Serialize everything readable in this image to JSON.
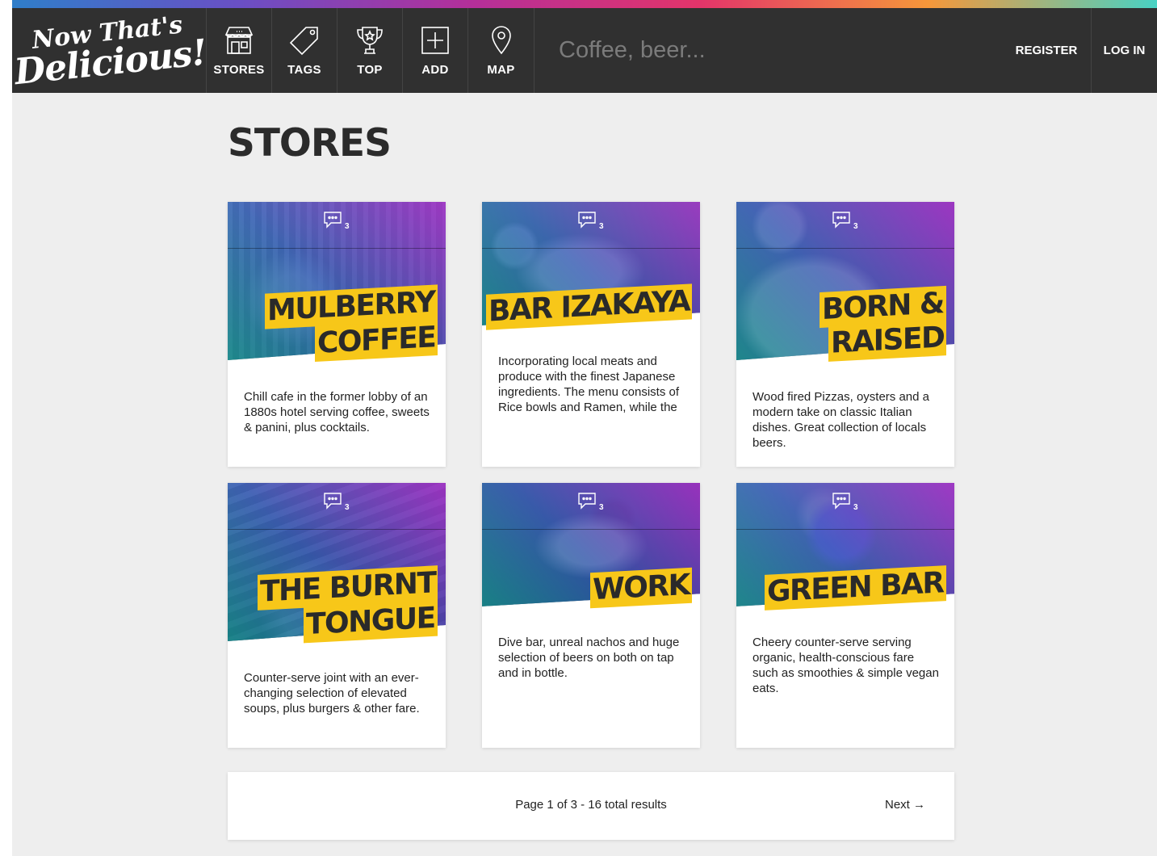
{
  "app": {
    "logo_line1": "Now That's",
    "logo_line2": "Delicious!"
  },
  "nav": [
    {
      "label": "STORES",
      "icon": "store-icon"
    },
    {
      "label": "TAGS",
      "icon": "tag-icon"
    },
    {
      "label": "TOP",
      "icon": "trophy-icon"
    },
    {
      "label": "ADD",
      "icon": "add-icon"
    },
    {
      "label": "MAP",
      "icon": "map-pin-icon"
    }
  ],
  "search": {
    "placeholder": "Coffee, beer..."
  },
  "auth": {
    "register": "REGISTER",
    "login": "LOG IN"
  },
  "page_title": "STORES",
  "stores": [
    {
      "name_lines": [
        "MULBERRY",
        "COFFEE"
      ],
      "comment_count": "3",
      "description": "Chill cafe in the former lobby of an 1880s hotel serving coffee, sweets & panini, plus cocktails."
    },
    {
      "name_lines": [
        "BAR IZAKAYA"
      ],
      "comment_count": "3",
      "description": "Incorporating local meats and produce with the finest Japanese ingredients. The menu consists of Rice bowls and Ramen, while the"
    },
    {
      "name_lines": [
        "BORN &",
        "RAISED"
      ],
      "comment_count": "3",
      "description": "Wood fired Pizzas, oysters and a modern take on classic Italian dishes. Great collection of locals beers."
    },
    {
      "name_lines": [
        "THE BURNT",
        "TONGUE"
      ],
      "comment_count": "3",
      "description": "Counter-serve joint with an ever-changing selection of elevated soups, plus burgers & other fare."
    },
    {
      "name_lines": [
        "WORK"
      ],
      "comment_count": "3",
      "description": "Dive bar, unreal nachos and huge selection of beers on both on tap and in bottle."
    },
    {
      "name_lines": [
        "GREEN BAR"
      ],
      "comment_count": "3",
      "description": "Cheery counter-serve serving organic, health-conscious fare such as smoothies & simple vegan eats."
    }
  ],
  "pagination": {
    "info": "Page 1 of 3 - 16 total results",
    "next": "Next →"
  },
  "colors": {
    "header": "#303030",
    "accent": "#f7c719",
    "background": "#eeeeee"
  }
}
